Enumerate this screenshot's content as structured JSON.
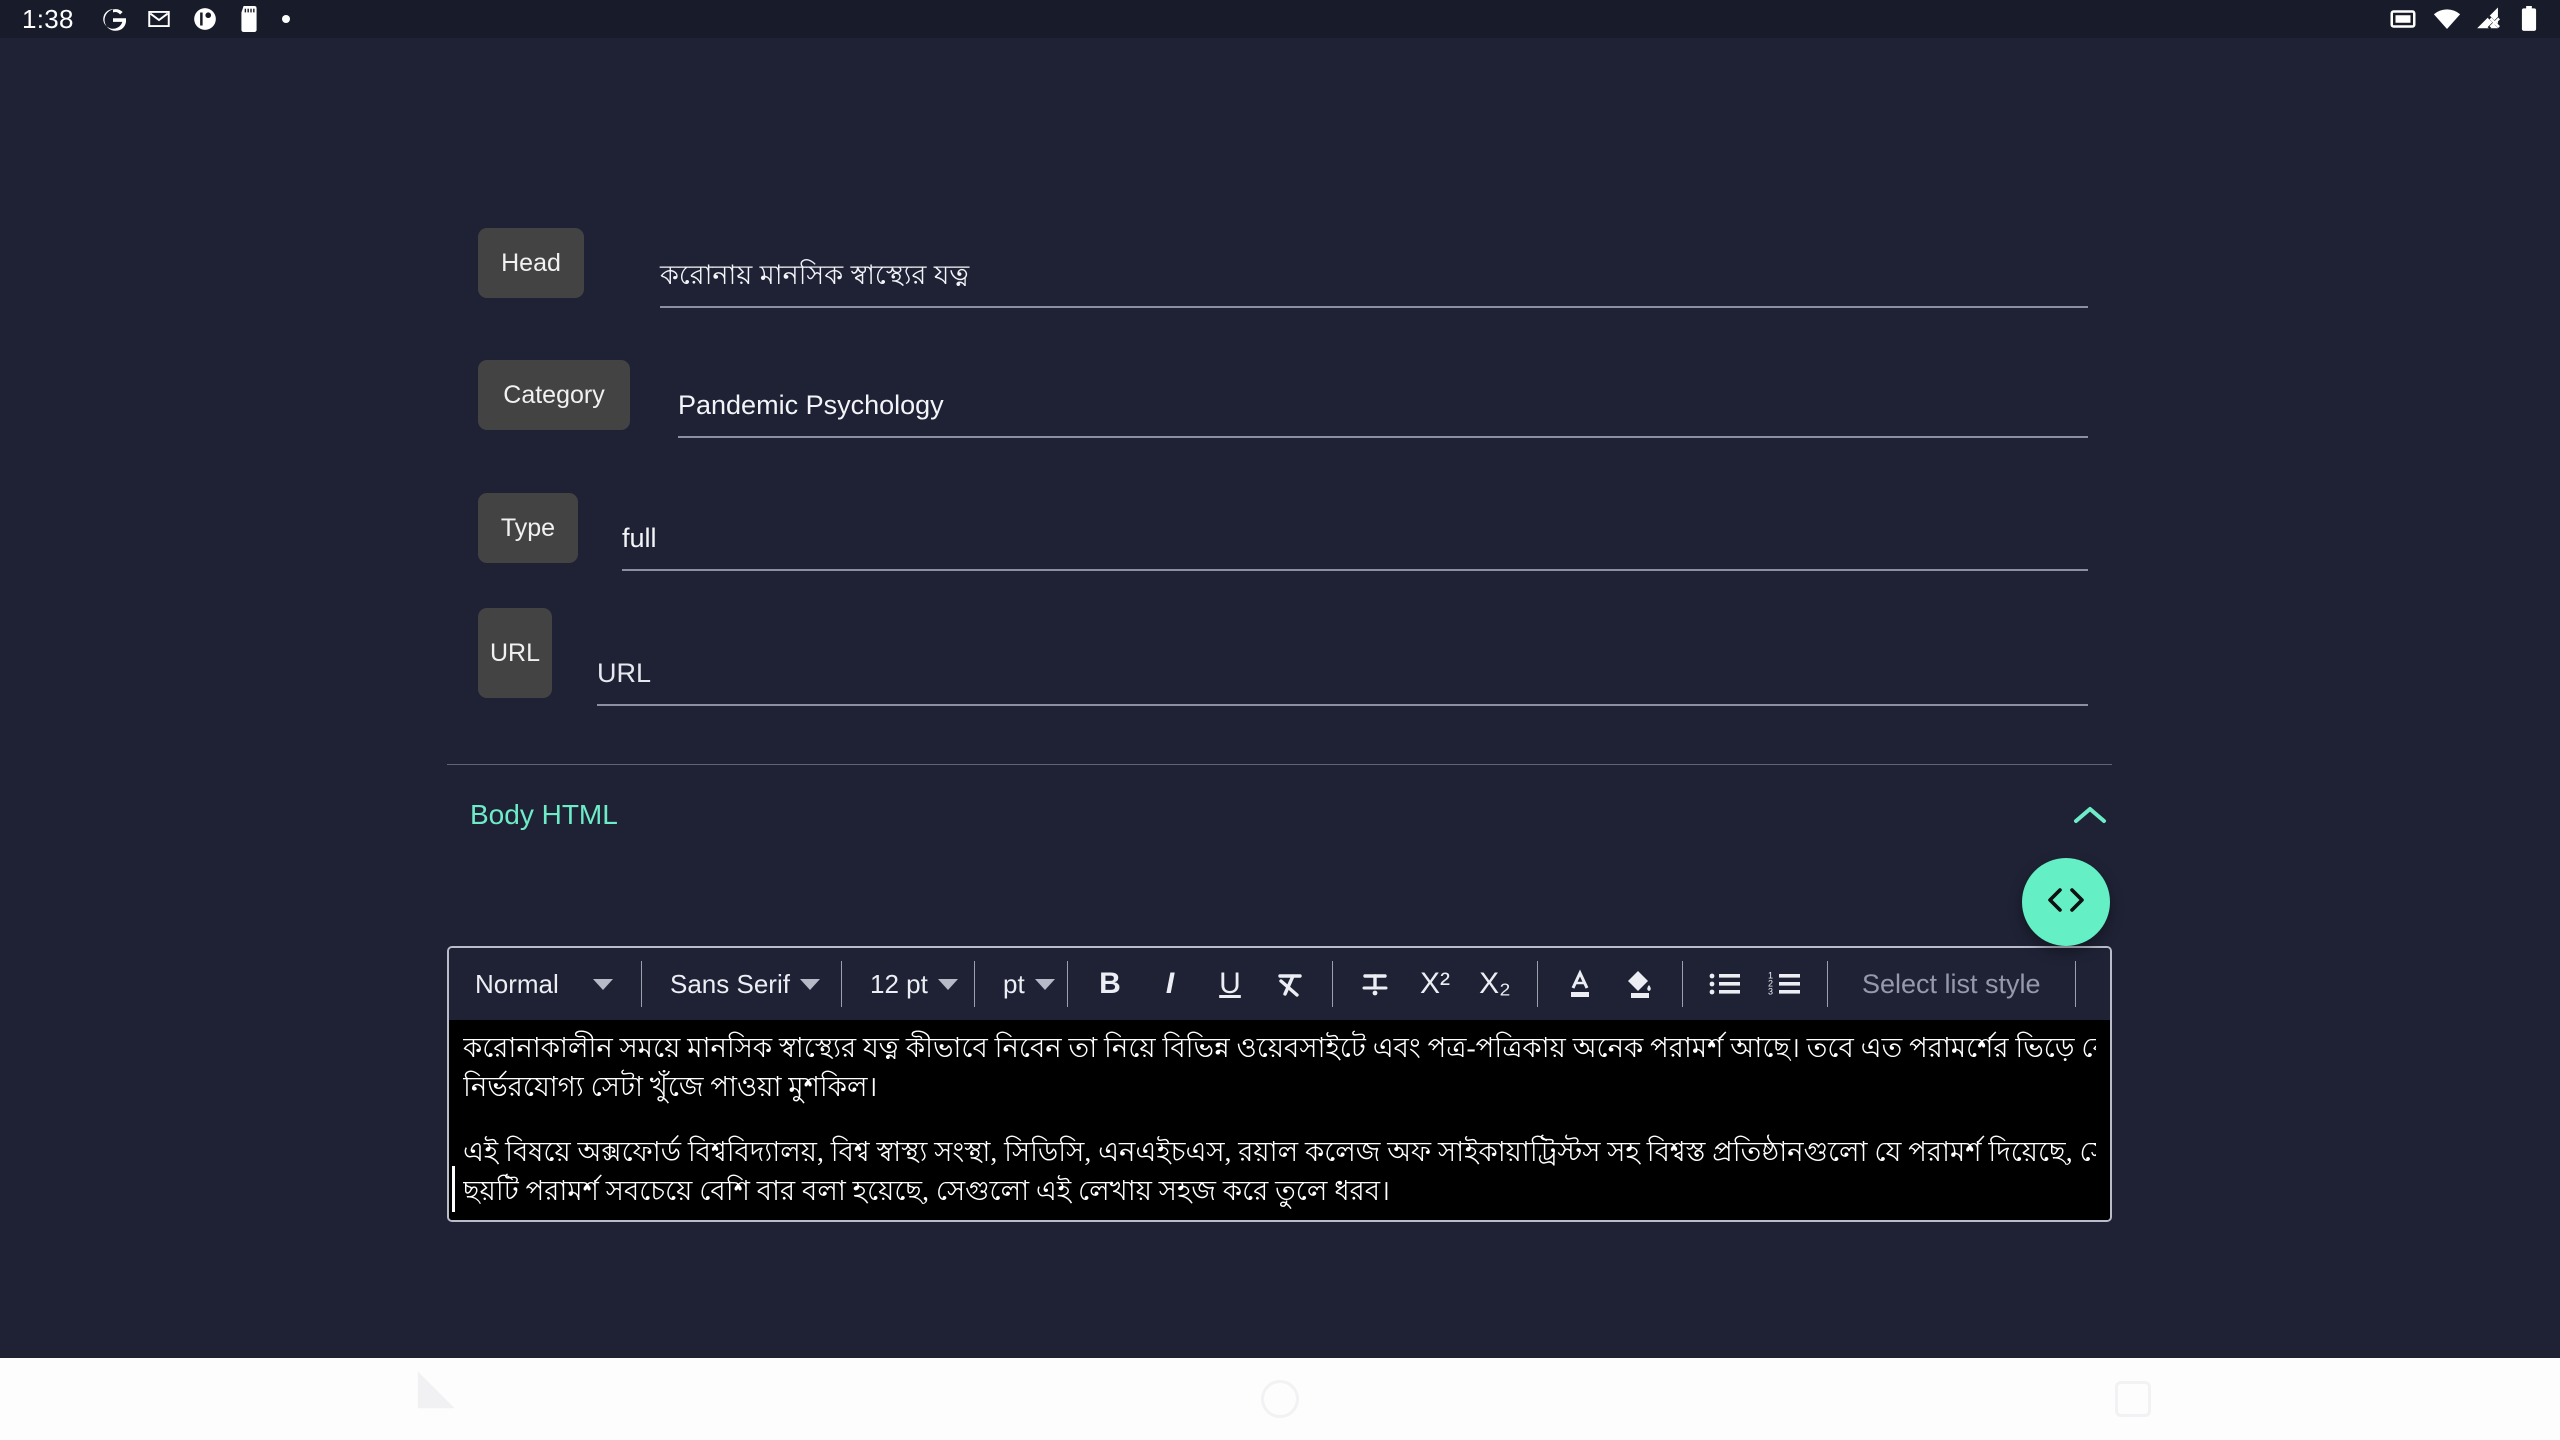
{
  "status_bar": {
    "time": "1:38",
    "left_icons": [
      "google-icon",
      "gmail-icon",
      "app-icon",
      "sd-card-icon",
      "dot-icon"
    ],
    "right_icons": [
      "cast-screen-icon",
      "wifi-icon",
      "cellular-off-icon",
      "battery-icon"
    ]
  },
  "form": {
    "fields": [
      {
        "label": "Head",
        "value": "করোনায় মানসিক স্বাস্থ্যের যত্ন"
      },
      {
        "label": "Category",
        "value": "Pandemic Psychology"
      },
      {
        "label": "Type",
        "value": "full"
      },
      {
        "label": "URL",
        "value": "URL"
      }
    ]
  },
  "body_section": {
    "label": "Body HTML",
    "label_color": "#6eecc8",
    "collapse_icon": "chevron-up-icon",
    "fab_icon": "code-brackets-icon",
    "fab_color": "#64efc4"
  },
  "editor": {
    "toolbar": {
      "block_style": "Normal",
      "font_family": "Sans Serif",
      "font_size": "12 pt",
      "font_unit": "pt",
      "bold": "B",
      "italic": "I",
      "underline": "U",
      "clear_format": "clear-formatting-icon",
      "strikethrough": "strikethrough-icon",
      "superscript": "X²",
      "subscript": "X₂",
      "text_color": "text-color-icon",
      "fill_color": "fill-color-icon",
      "bulleted_list": "bulleted-list-icon",
      "numbered_list": "numbered-list-icon",
      "list_style_placeholder": "Select list style"
    },
    "content": {
      "paragraph_1_line_1": "করোনাকালীন সময়ে মানসিক স্বাস্থ্যের যত্ন কীভাবে নিবেন তা নিয়ে বিভিন্ন ওয়েবসাইটে এবং পত্র-পত্রিকায় অনেক পরামর্শ আছে। তবে এত পরামর্শের ভিড়ে কোন পরামর্শগুলো",
      "paragraph_1_line_2": "নির্ভরযোগ্য সেটা খুঁজে পাওয়া মুশকিল।",
      "paragraph_2_line_1": "এই বিষয়ে অক্সফোর্ড বিশ্ববিদ্যালয়, বিশ্ব স্বাস্থ্য সংস্থা, সিডিসি, এনএইচএস, রয়াল কলেজ অফ সাইকায়াট্রিস্টস সহ বিশ্বস্ত প্রতিষ্ঠানগুলো যে পরামর্শ দিয়েছে, সেগুলোর মধ্যে যে",
      "paragraph_2_line_2": "ছয়টি পরামর্শ সবচেয়ে বেশি বার বলা হয়েছে, সেগুলো এই লেখায় সহজ করে তুলে ধরব।"
    }
  },
  "navigation_bar": {
    "back": "back-triangle-icon",
    "home": "home-circle-icon",
    "recents": "recents-square-icon"
  }
}
